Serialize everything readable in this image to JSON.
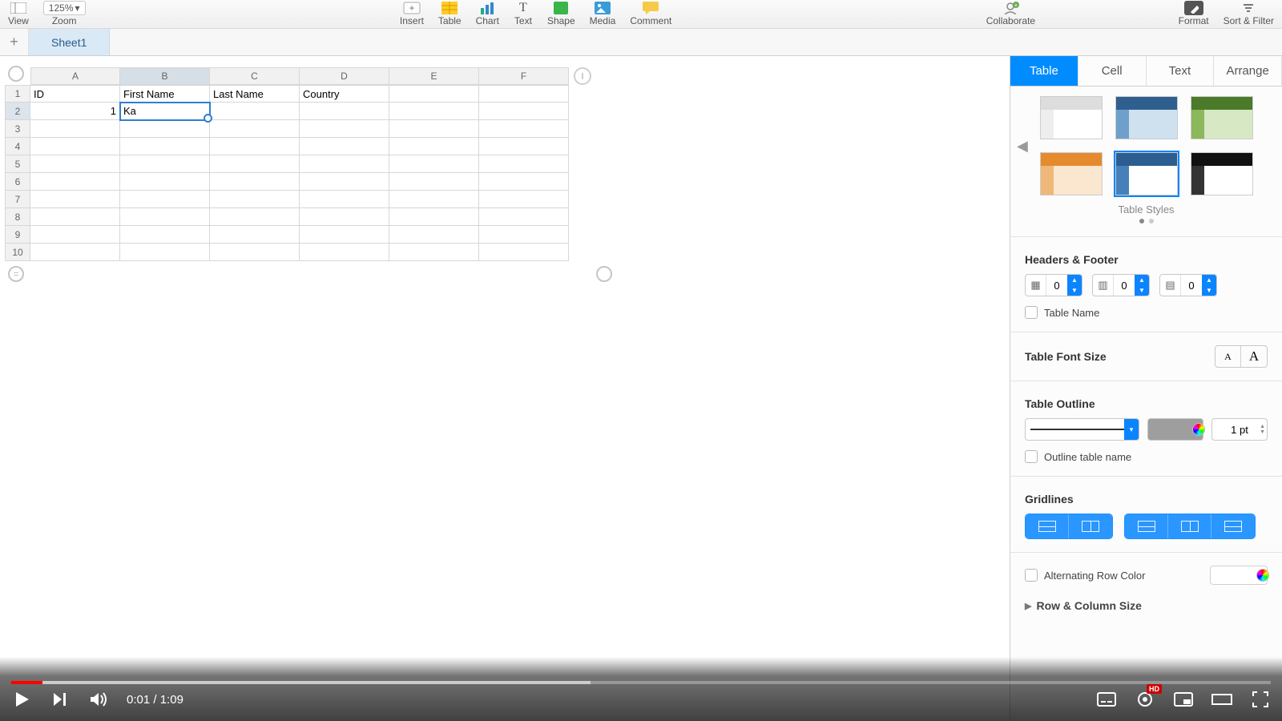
{
  "toolbar": {
    "zoom_value": "125%",
    "view_label": "View",
    "zoom_label": "Zoom",
    "insert_label": "Insert",
    "table_label": "Table",
    "chart_label": "Chart",
    "text_label": "Text",
    "shape_label": "Shape",
    "media_label": "Media",
    "comment_label": "Comment",
    "collaborate_label": "Collaborate",
    "format_label": "Format",
    "sort_filter_label": "Sort & Filter"
  },
  "sheetbar": {
    "tab1": "Sheet1"
  },
  "spreadsheet": {
    "columns": [
      "A",
      "B",
      "C",
      "D",
      "E",
      "F"
    ],
    "rows": [
      "1",
      "2",
      "3",
      "4",
      "5",
      "6",
      "7",
      "8",
      "9",
      "10"
    ],
    "active_col_index": 1,
    "active_row_index": 1,
    "headers": {
      "A1": "ID",
      "B1": "First Name",
      "C1": "Last Name",
      "D1": "Country"
    },
    "data": {
      "A2": "1",
      "B2": "Ka"
    }
  },
  "inspector": {
    "tabs": {
      "table": "Table",
      "cell": "Cell",
      "text": "Text",
      "arrange": "Arrange"
    },
    "styles_caption": "Table Styles",
    "headers_footer": {
      "title": "Headers & Footer",
      "header_rows": "0",
      "header_cols": "0",
      "footer_rows": "0",
      "table_name_label": "Table Name"
    },
    "font_size": {
      "title": "Table Font Size"
    },
    "outline": {
      "title": "Table Outline",
      "pt_value": "1 pt",
      "outline_name_label": "Outline table name"
    },
    "gridlines": {
      "title": "Gridlines"
    },
    "alt_row": {
      "label": "Alternating Row Color"
    },
    "row_col_size": {
      "label": "Row & Column Size"
    }
  },
  "video": {
    "current": "0:01",
    "sep": " / ",
    "duration": "1:09"
  }
}
